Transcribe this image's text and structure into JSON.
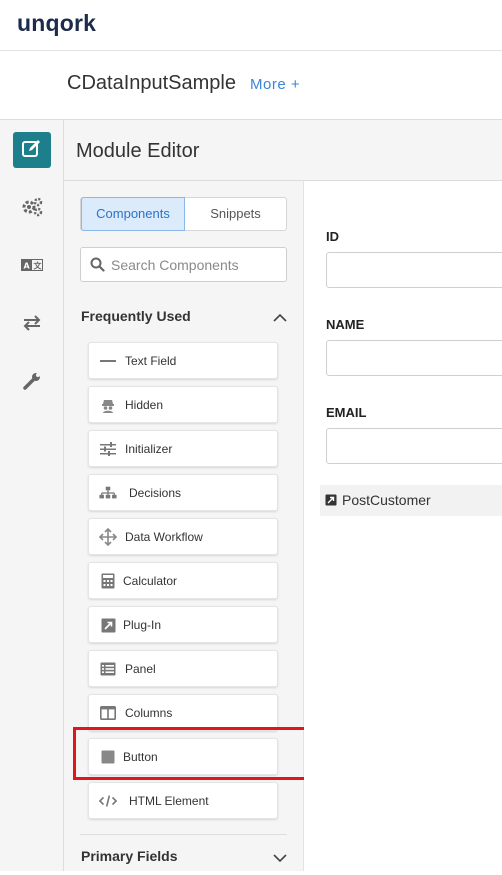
{
  "brand": {
    "logo_text": "unqork"
  },
  "app": {
    "title": "CDataInputSample",
    "more_link": "More +"
  },
  "editor": {
    "title": "Module Editor"
  },
  "rail": {
    "items": [
      {
        "icon": "edit-icon",
        "active": true
      },
      {
        "icon": "gears-icon",
        "active": false
      },
      {
        "icon": "translate-icon",
        "active": false
      },
      {
        "icon": "swap-arrows-icon",
        "active": false
      },
      {
        "icon": "wrench-icon",
        "active": false
      }
    ]
  },
  "panel": {
    "tabs": {
      "components": "Components",
      "snippets": "Snippets"
    },
    "search": {
      "placeholder": "Search Components",
      "value": ""
    },
    "frequently_used": {
      "label": "Frequently Used",
      "items": [
        {
          "label": "Text Field",
          "icon": "text-field-icon"
        },
        {
          "label": "Hidden",
          "icon": "hidden-icon"
        },
        {
          "label": "Initializer",
          "icon": "sliders-icon"
        },
        {
          "label": "Decisions",
          "icon": "sitemap-icon"
        },
        {
          "label": "Data Workflow",
          "icon": "move-arrows-icon"
        },
        {
          "label": "Calculator",
          "icon": "calculator-icon"
        },
        {
          "label": "Plug-In",
          "icon": "plug-in-icon"
        },
        {
          "label": "Panel",
          "icon": "panel-list-icon"
        },
        {
          "label": "Columns",
          "icon": "columns-icon"
        },
        {
          "label": "Button",
          "icon": "button-square-icon"
        },
        {
          "label": "HTML Element",
          "icon": "code-icon"
        }
      ]
    },
    "primary_fields": {
      "label": "Primary Fields"
    }
  },
  "preview": {
    "fields": [
      {
        "label": "ID",
        "value": ""
      },
      {
        "label": "NAME",
        "value": ""
      },
      {
        "label": "EMAIL",
        "value": ""
      }
    ],
    "button_label": "PostCustomer"
  },
  "colors": {
    "accent": "#1d7e8c",
    "link": "#3a86d8",
    "highlight": "#e0161b",
    "tab_selected_bg": "#dcebfb"
  }
}
